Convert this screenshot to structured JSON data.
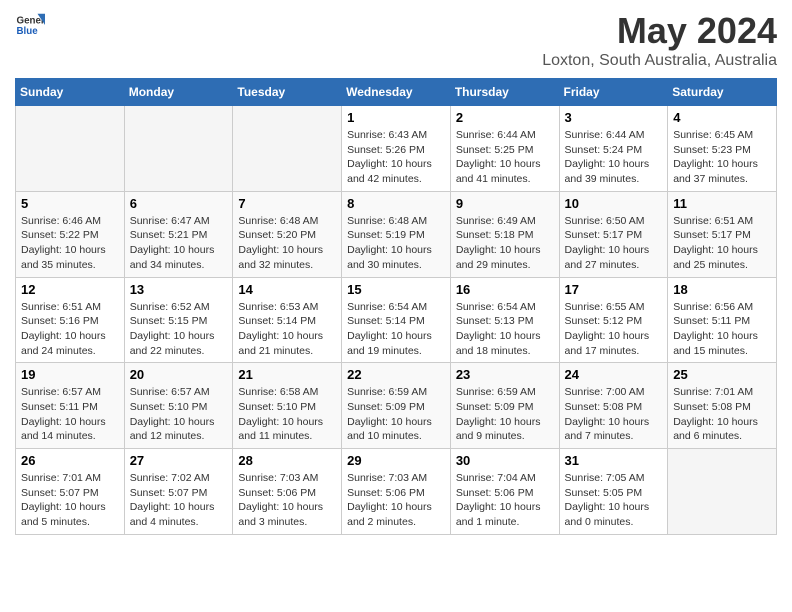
{
  "header": {
    "logo_general": "General",
    "logo_blue": "Blue",
    "title": "May 2024",
    "subtitle": "Loxton, South Australia, Australia"
  },
  "weekdays": [
    "Sunday",
    "Monday",
    "Tuesday",
    "Wednesday",
    "Thursday",
    "Friday",
    "Saturday"
  ],
  "weeks": [
    [
      {
        "day": "",
        "info": ""
      },
      {
        "day": "",
        "info": ""
      },
      {
        "day": "",
        "info": ""
      },
      {
        "day": "1",
        "info": "Sunrise: 6:43 AM\nSunset: 5:26 PM\nDaylight: 10 hours\nand 42 minutes."
      },
      {
        "day": "2",
        "info": "Sunrise: 6:44 AM\nSunset: 5:25 PM\nDaylight: 10 hours\nand 41 minutes."
      },
      {
        "day": "3",
        "info": "Sunrise: 6:44 AM\nSunset: 5:24 PM\nDaylight: 10 hours\nand 39 minutes."
      },
      {
        "day": "4",
        "info": "Sunrise: 6:45 AM\nSunset: 5:23 PM\nDaylight: 10 hours\nand 37 minutes."
      }
    ],
    [
      {
        "day": "5",
        "info": "Sunrise: 6:46 AM\nSunset: 5:22 PM\nDaylight: 10 hours\nand 35 minutes."
      },
      {
        "day": "6",
        "info": "Sunrise: 6:47 AM\nSunset: 5:21 PM\nDaylight: 10 hours\nand 34 minutes."
      },
      {
        "day": "7",
        "info": "Sunrise: 6:48 AM\nSunset: 5:20 PM\nDaylight: 10 hours\nand 32 minutes."
      },
      {
        "day": "8",
        "info": "Sunrise: 6:48 AM\nSunset: 5:19 PM\nDaylight: 10 hours\nand 30 minutes."
      },
      {
        "day": "9",
        "info": "Sunrise: 6:49 AM\nSunset: 5:18 PM\nDaylight: 10 hours\nand 29 minutes."
      },
      {
        "day": "10",
        "info": "Sunrise: 6:50 AM\nSunset: 5:17 PM\nDaylight: 10 hours\nand 27 minutes."
      },
      {
        "day": "11",
        "info": "Sunrise: 6:51 AM\nSunset: 5:17 PM\nDaylight: 10 hours\nand 25 minutes."
      }
    ],
    [
      {
        "day": "12",
        "info": "Sunrise: 6:51 AM\nSunset: 5:16 PM\nDaylight: 10 hours\nand 24 minutes."
      },
      {
        "day": "13",
        "info": "Sunrise: 6:52 AM\nSunset: 5:15 PM\nDaylight: 10 hours\nand 22 minutes."
      },
      {
        "day": "14",
        "info": "Sunrise: 6:53 AM\nSunset: 5:14 PM\nDaylight: 10 hours\nand 21 minutes."
      },
      {
        "day": "15",
        "info": "Sunrise: 6:54 AM\nSunset: 5:14 PM\nDaylight: 10 hours\nand 19 minutes."
      },
      {
        "day": "16",
        "info": "Sunrise: 6:54 AM\nSunset: 5:13 PM\nDaylight: 10 hours\nand 18 minutes."
      },
      {
        "day": "17",
        "info": "Sunrise: 6:55 AM\nSunset: 5:12 PM\nDaylight: 10 hours\nand 17 minutes."
      },
      {
        "day": "18",
        "info": "Sunrise: 6:56 AM\nSunset: 5:11 PM\nDaylight: 10 hours\nand 15 minutes."
      }
    ],
    [
      {
        "day": "19",
        "info": "Sunrise: 6:57 AM\nSunset: 5:11 PM\nDaylight: 10 hours\nand 14 minutes."
      },
      {
        "day": "20",
        "info": "Sunrise: 6:57 AM\nSunset: 5:10 PM\nDaylight: 10 hours\nand 12 minutes."
      },
      {
        "day": "21",
        "info": "Sunrise: 6:58 AM\nSunset: 5:10 PM\nDaylight: 10 hours\nand 11 minutes."
      },
      {
        "day": "22",
        "info": "Sunrise: 6:59 AM\nSunset: 5:09 PM\nDaylight: 10 hours\nand 10 minutes."
      },
      {
        "day": "23",
        "info": "Sunrise: 6:59 AM\nSunset: 5:09 PM\nDaylight: 10 hours\nand 9 minutes."
      },
      {
        "day": "24",
        "info": "Sunrise: 7:00 AM\nSunset: 5:08 PM\nDaylight: 10 hours\nand 7 minutes."
      },
      {
        "day": "25",
        "info": "Sunrise: 7:01 AM\nSunset: 5:08 PM\nDaylight: 10 hours\nand 6 minutes."
      }
    ],
    [
      {
        "day": "26",
        "info": "Sunrise: 7:01 AM\nSunset: 5:07 PM\nDaylight: 10 hours\nand 5 minutes."
      },
      {
        "day": "27",
        "info": "Sunrise: 7:02 AM\nSunset: 5:07 PM\nDaylight: 10 hours\nand 4 minutes."
      },
      {
        "day": "28",
        "info": "Sunrise: 7:03 AM\nSunset: 5:06 PM\nDaylight: 10 hours\nand 3 minutes."
      },
      {
        "day": "29",
        "info": "Sunrise: 7:03 AM\nSunset: 5:06 PM\nDaylight: 10 hours\nand 2 minutes."
      },
      {
        "day": "30",
        "info": "Sunrise: 7:04 AM\nSunset: 5:06 PM\nDaylight: 10 hours\nand 1 minute."
      },
      {
        "day": "31",
        "info": "Sunrise: 7:05 AM\nSunset: 5:05 PM\nDaylight: 10 hours\nand 0 minutes."
      },
      {
        "day": "",
        "info": ""
      }
    ]
  ]
}
